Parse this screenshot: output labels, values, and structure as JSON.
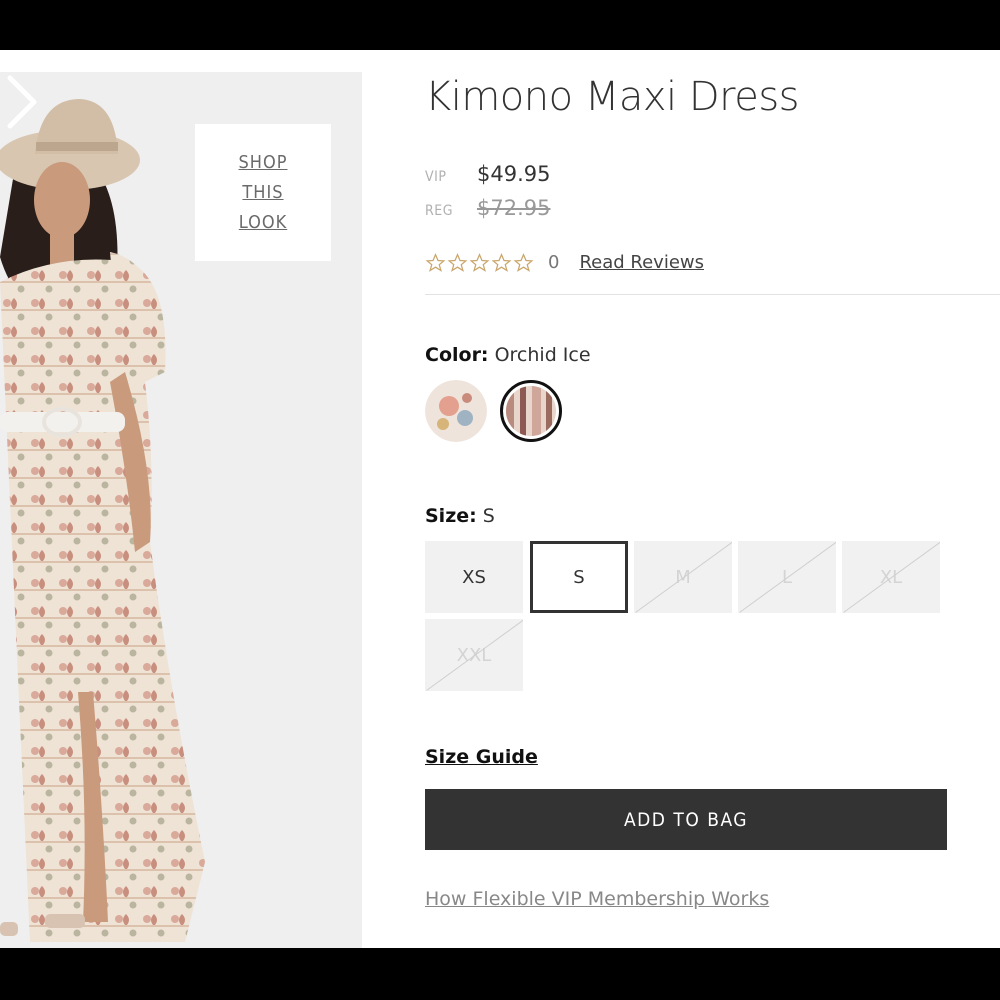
{
  "product": {
    "title": "Kimono Maxi Dress",
    "vip_label": "VIP",
    "vip_price": "$49.95",
    "reg_label": "REG",
    "reg_price": "$72.95",
    "rating_stars": 0,
    "review_count": "0",
    "read_reviews_label": "Read Reviews"
  },
  "image": {
    "shop_look_label": "SHOP\nTHIS\nLOOK",
    "next_icon": "chevron-right-icon"
  },
  "color": {
    "label": "Color:",
    "selected": "Orchid Ice",
    "swatches": [
      "floral-ivory",
      "orchid-ice"
    ]
  },
  "size": {
    "label": "Size:",
    "selected": "S",
    "options": [
      {
        "label": "XS",
        "available": true
      },
      {
        "label": "S",
        "available": true
      },
      {
        "label": "M",
        "available": false
      },
      {
        "label": "L",
        "available": false
      },
      {
        "label": "XL",
        "available": false
      },
      {
        "label": "XXL",
        "available": false
      }
    ]
  },
  "actions": {
    "size_guide": "Size Guide",
    "add_to_bag": "ADD TO BAG",
    "vip_link": "How Flexible VIP Membership Works"
  },
  "colors": {
    "button_bg": "#333333",
    "star_outline": "#c9a66b",
    "sold_out_text": "#d4d4d4"
  }
}
